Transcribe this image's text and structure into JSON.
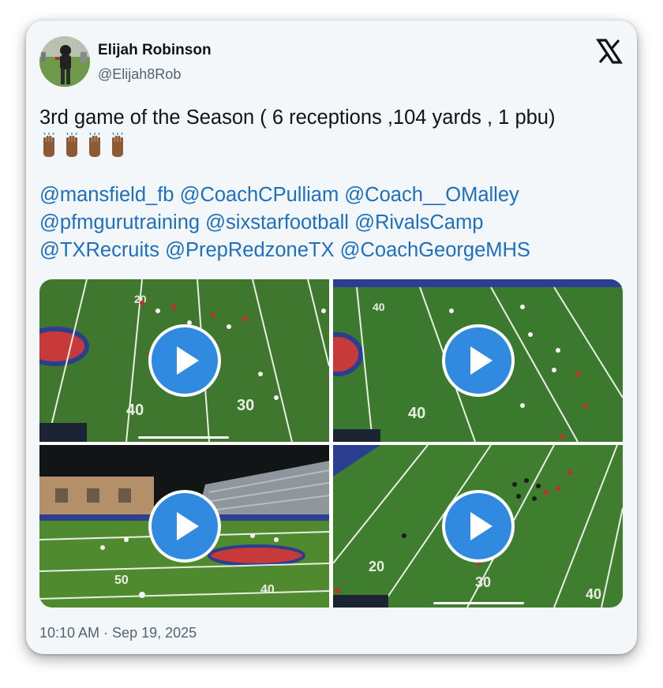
{
  "author": {
    "name": "Elijah Robinson",
    "handle": "@Elijah8Rob",
    "avatar_icon": "player-avatar"
  },
  "platform_icon": "x-logo-icon",
  "tweet": {
    "text": "3rd game of the Season  ( 6 receptions ,104 yards , 1 pbu)",
    "emoji_line": "👏🏾👏🏾👏🏾👏🏾",
    "mentions": [
      "@mansfield_fb",
      "@CoachCPulliam",
      "@Coach__OMalley",
      "@pfmgurutraining",
      "@sixstarfootball",
      "@RivalsCamp",
      "@TXRecruits",
      "@PrepRedzoneTX",
      "@CoachGeorgeMHS"
    ]
  },
  "media": {
    "videos": [
      {
        "scene": "football-field-aerial",
        "field_numbers": [
          "20",
          "40",
          "30"
        ],
        "play_icon": "play-icon"
      },
      {
        "scene": "football-field-aerial",
        "field_numbers": [
          "40",
          "40"
        ],
        "play_icon": "play-icon"
      },
      {
        "scene": "stadium-sideline",
        "field_numbers": [
          "50",
          "40"
        ],
        "play_icon": "play-icon"
      },
      {
        "scene": "football-field-aerial",
        "field_numbers": [
          "20",
          "30",
          "40"
        ],
        "play_icon": "play-icon"
      }
    ]
  },
  "timestamp": "10:10 AM · Sep 19, 2025",
  "colors": {
    "link": "#1d6fc0",
    "play_button": "#2f8ae0",
    "field_green": "#3f7a2f",
    "card_background": "#f4f7fa"
  }
}
